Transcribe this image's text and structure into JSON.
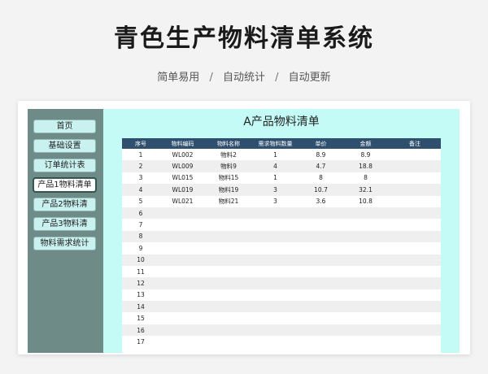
{
  "hero": {
    "title": "青色生产物料清单系统",
    "subtitle_parts": [
      "简单易用",
      "自动统计",
      "自动更新"
    ],
    "separator": "/"
  },
  "sidebar": {
    "items": [
      {
        "label": "首页",
        "active": false
      },
      {
        "label": "基础设置",
        "active": false
      },
      {
        "label": "订单统计表",
        "active": false
      },
      {
        "label": "产品1物料清单",
        "active": true
      },
      {
        "label": "产品2物料清",
        "active": false
      },
      {
        "label": "产品3物料清",
        "active": false
      },
      {
        "label": "物料需求统计",
        "active": false
      }
    ]
  },
  "main": {
    "title": "A产品物料清单",
    "table": {
      "headers": [
        "序号",
        "物料编码",
        "物料名称",
        "需求物料数量",
        "单价",
        "金额",
        "备注"
      ],
      "rows": [
        [
          "1",
          "WL002",
          "物料2",
          "1",
          "8.9",
          "8.9",
          ""
        ],
        [
          "2",
          "WL009",
          "物料9",
          "4",
          "4.7",
          "18.8",
          ""
        ],
        [
          "3",
          "WL015",
          "物料15",
          "1",
          "8",
          "8",
          ""
        ],
        [
          "4",
          "WL019",
          "物料19",
          "3",
          "10.7",
          "32.1",
          ""
        ],
        [
          "5",
          "WL021",
          "物料21",
          "3",
          "3.6",
          "10.8",
          ""
        ],
        [
          "6",
          "",
          "",
          "",
          "",
          "",
          ""
        ],
        [
          "7",
          "",
          "",
          "",
          "",
          "",
          ""
        ],
        [
          "8",
          "",
          "",
          "",
          "",
          "",
          ""
        ],
        [
          "9",
          "",
          "",
          "",
          "",
          "",
          ""
        ],
        [
          "10",
          "",
          "",
          "",
          "",
          "",
          ""
        ],
        [
          "11",
          "",
          "",
          "",
          "",
          "",
          ""
        ],
        [
          "12",
          "",
          "",
          "",
          "",
          "",
          ""
        ],
        [
          "13",
          "",
          "",
          "",
          "",
          "",
          ""
        ],
        [
          "14",
          "",
          "",
          "",
          "",
          "",
          ""
        ],
        [
          "15",
          "",
          "",
          "",
          "",
          "",
          ""
        ],
        [
          "16",
          "",
          "",
          "",
          "",
          "",
          ""
        ],
        [
          "17",
          "",
          "",
          "",
          "",
          "",
          ""
        ]
      ]
    }
  },
  "colors": {
    "sidebar_bg": "#6e8b88",
    "nav_button_bg": "#c9f1ef",
    "main_bg": "#c4fbf6",
    "table_header_bg": "#2f4f6f"
  }
}
